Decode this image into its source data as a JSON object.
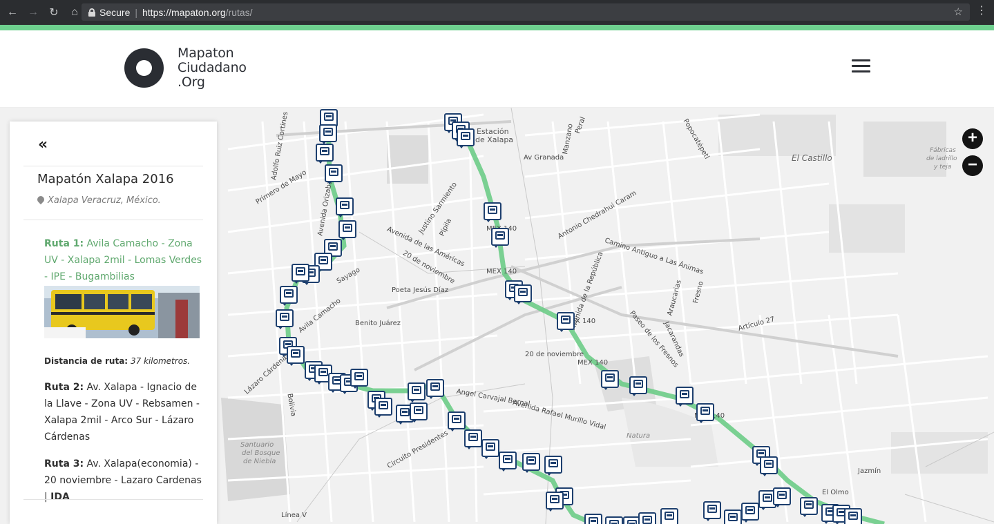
{
  "browser": {
    "secure_label": "Secure",
    "url_host": "https://mapaton.org",
    "url_path": "/rutas/"
  },
  "site": {
    "logo_line1": "Mapaton",
    "logo_line2": "Ciudadano",
    "logo_line3": ".Org"
  },
  "panel": {
    "collapse_label": "«",
    "title": "Mapatón Xalapa 2016",
    "location": "Xalapa Veracruz, México.",
    "route1_name": "Ruta 1:",
    "route1_desc": " Avila Camacho - Zona UV - Xalapa 2mil - Lomas Verdes - IPE - Bugambilias",
    "distance_label": "Distancia de ruta:",
    "distance_value": "37 kilometros.",
    "route2_name": "Ruta 2:",
    "route2_desc": " Av. Xalapa - Ignacio de la Llave - Zona UV - Rebsamen - Xalapa 2mil - Arco Sur - Lázaro Cárdenas",
    "route3_name": "Ruta 3:",
    "route3_desc": " Av. Xalapa(economia) - 20 noviembre - Lazaro Cardenas | ",
    "route3_dir": "IDA"
  },
  "map": {
    "zoom_in": "+",
    "zoom_out": "−",
    "route_color": "#6dcc87",
    "marker_color": "#1d3f6e",
    "labels": {
      "estacion": "Estación",
      "de_xalapa": "de Xalapa",
      "el_castillo": "El Castillo",
      "fabricas1": "Fábricas",
      "fabricas2": "de ladrillo",
      "fabricas3": "y teja",
      "av_granada": "Av Granada",
      "primero_de_mayo": "Primero de Mayo",
      "avenida_las_americas": "Avenida de las Américas",
      "justino_sarmiento": "Justino Sarmiento",
      "avenida_orizaba": "Avenida Orizaba",
      "adolfo_ruiz_cortines": "Adolfo Ruiz Cortines",
      "mex140_1": "MEX 140",
      "mex140_2": "MEX 140",
      "mex140_3": "MEX 140",
      "mex140_4": "MEX 140",
      "mex140_5": "MEX 140",
      "antonio_chedrahui": "Antonio Chedrahui Caram",
      "camino_antiguo": "Camino Antiguo a Las Ánimas",
      "avenida_republica": "Avenida de la República",
      "poeta_jesus_diaz": "Poeta Jesús Díaz",
      "benito_juarez": "Benito Juárez",
      "20_noviembre_1": "20 de noviembre",
      "20_noviembre_2": "20 de noviembre",
      "lazaro_cardenas": "Lázaro Cárdenas",
      "avila_camacho": "Avila Camacho",
      "articulo_27": "Artículo 27",
      "paseo_fresnos": "Paseo de los Fresnos",
      "jacarandas": "Jacarandas",
      "araucarias": "Araucarias",
      "fresno": "Fresno",
      "natura": "Natura",
      "santuario1": "Santuario",
      "santuario2": "del Bosque",
      "santuario3": "de Niebla",
      "circuito_presidentes": "Circuito Presidentes",
      "avenida_murillo": "Avenida Rafael Murillo Vidal",
      "angel_carvajal": "Angel Carvajal Bernal",
      "jazmin": "Jazmín",
      "el_olmo": "El Olmo",
      "linea_v": "Línea V",
      "bolivia": "Bolivia",
      "pipila": "Pípila",
      "sayago": "Sayago",
      "manzano": "Manzano",
      "peral": "Peral",
      "popocatepetl": "Popocatépetl"
    }
  }
}
